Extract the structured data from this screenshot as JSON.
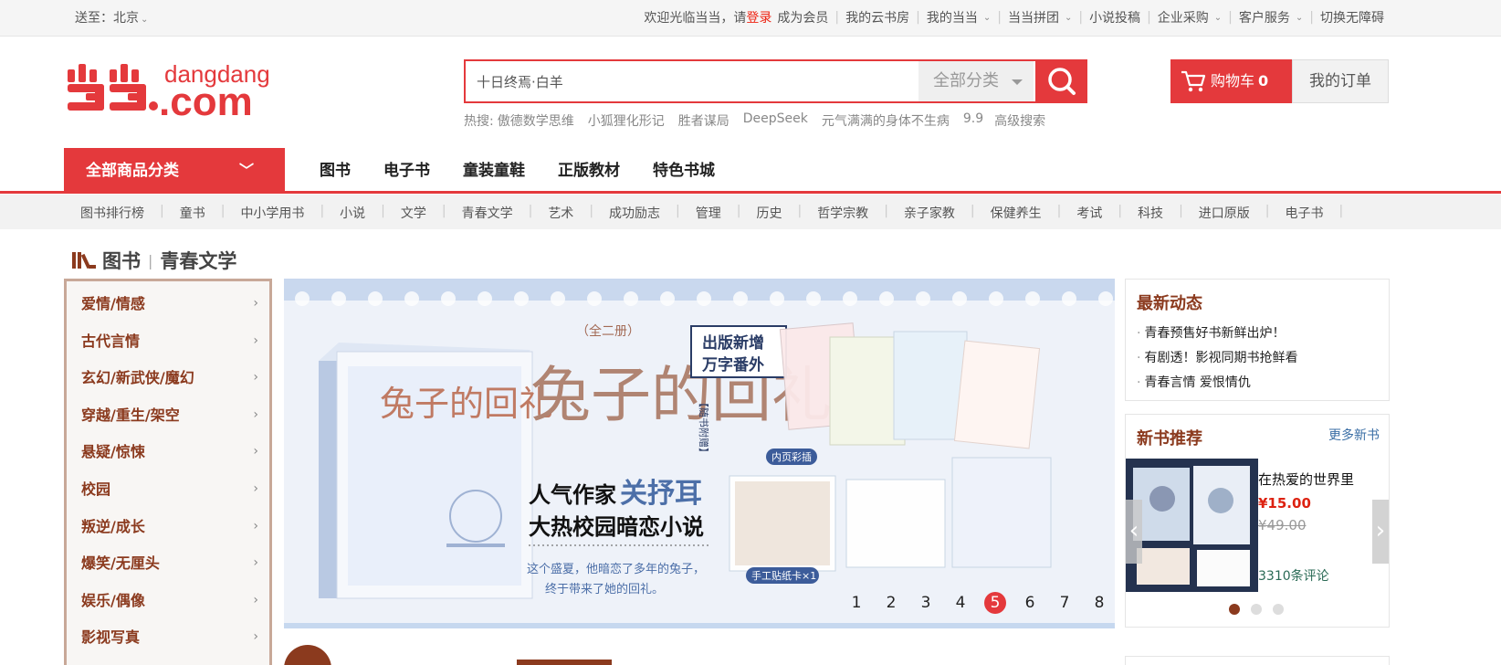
{
  "topbar": {
    "ship_to": "送至：北京",
    "welcome": "欢迎光临当当，请",
    "login": "登录",
    "register": "成为会员",
    "links": [
      "我的云书房",
      "我的当当",
      "当当拼团",
      "小说投稿",
      "企业采购",
      "客户服务",
      "切换无障碍"
    ]
  },
  "logo": {
    "text": "dangdang",
    "domain": ".com",
    "brand_color": "#e4393c"
  },
  "search": {
    "value": "十日终焉·白羊",
    "category": "全部分类",
    "hot_label": "热搜:",
    "hotwords": [
      "傲德数学思维",
      "小狐狸化形记",
      "胜者谋局",
      "DeepSeek",
      "元气满满的身体不生病",
      "9.9",
      "高级搜索"
    ]
  },
  "cart": {
    "label": "购物车",
    "count": "0"
  },
  "orders": "我的订单",
  "nav": {
    "all_categories": "全部商品分类",
    "items": [
      "图书",
      "电子书",
      "童装童鞋",
      "正版教材",
      "特色书城"
    ]
  },
  "subnav": [
    "图书排行榜",
    "童书",
    "中小学用书",
    "小说",
    "文学",
    "青春文学",
    "艺术",
    "成功励志",
    "管理",
    "历史",
    "哲学宗教",
    "亲子家教",
    "保健养生",
    "考试",
    "科技",
    "进口原版",
    "电子书"
  ],
  "breadcrumb": {
    "root": "图书",
    "current": "青春文学"
  },
  "categories": [
    "爱情/情感",
    "古代言情",
    "玄幻/新武侠/魔幻",
    "穿越/重生/架空",
    "悬疑/惊悚",
    "校园",
    "叛逆/成长",
    "爆笑/无厘头",
    "娱乐/偶像",
    "影视写真"
  ],
  "banner": {
    "title_small": "（全二册）",
    "title": "兔子的回礼",
    "badge_line1": "出版新增",
    "badge_line2": "万字番外",
    "gift_label": "【随书附赠】",
    "tag_inner": "内页彩插",
    "tag_sticker": "手工贴纸卡×1",
    "slogan1_prefix": "人气作家",
    "slogan1_name": "关抒耳",
    "slogan2": "大热校园暗恋小说",
    "desc1": "这个盛夏，他暗恋了多年的兔子，",
    "desc2": "终于带来了她的回礼。",
    "pages": [
      "1",
      "2",
      "3",
      "4",
      "5",
      "6",
      "7",
      "8"
    ],
    "active_page": "5"
  },
  "news": {
    "title": "最新动态",
    "items": [
      "青春预售好书新鲜出炉！",
      "有剧透！影视同期书抢鲜看",
      "青春言情 爱恨情仇"
    ]
  },
  "newbooks": {
    "title": "新书推荐",
    "more": "更多新书",
    "book_title": "在热爱的世界里",
    "price": "¥15.00",
    "old_price": "¥49.00",
    "reviews": "3310条评论"
  }
}
